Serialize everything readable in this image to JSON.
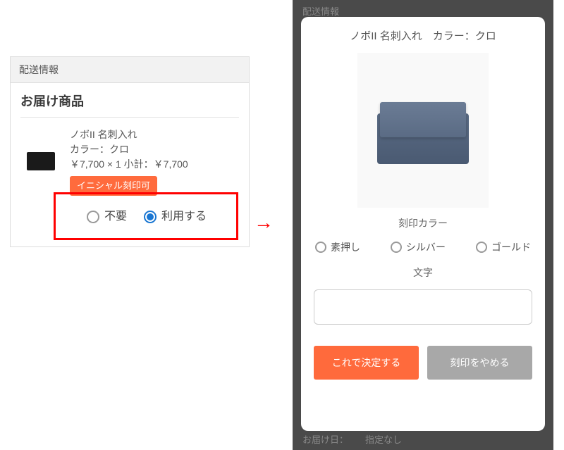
{
  "left": {
    "shipping_header": "配送情報",
    "items_title": "お届け商品",
    "item": {
      "name": "ノボII 名刺入れ",
      "color_line": "カラー：クロ",
      "price_line": "￥7,700 × 1  小計：￥7,700"
    },
    "badge": "イニシャル刻印可",
    "radio_not_needed": "不要",
    "radio_use": "利用する"
  },
  "arrow": "→",
  "right": {
    "bg_header": "配送情報",
    "bg_footer_label": "お届け日：",
    "bg_footer_value": "指定なし",
    "title": "ノボII 名刺入れ　カラー：クロ",
    "engrave_color_label": "刻印カラー",
    "colors": {
      "blind": "素押し",
      "silver": "シルバー",
      "gold": "ゴールド"
    },
    "text_label": "文字",
    "confirm": "これで決定する",
    "cancel": "刻印をやめる"
  }
}
